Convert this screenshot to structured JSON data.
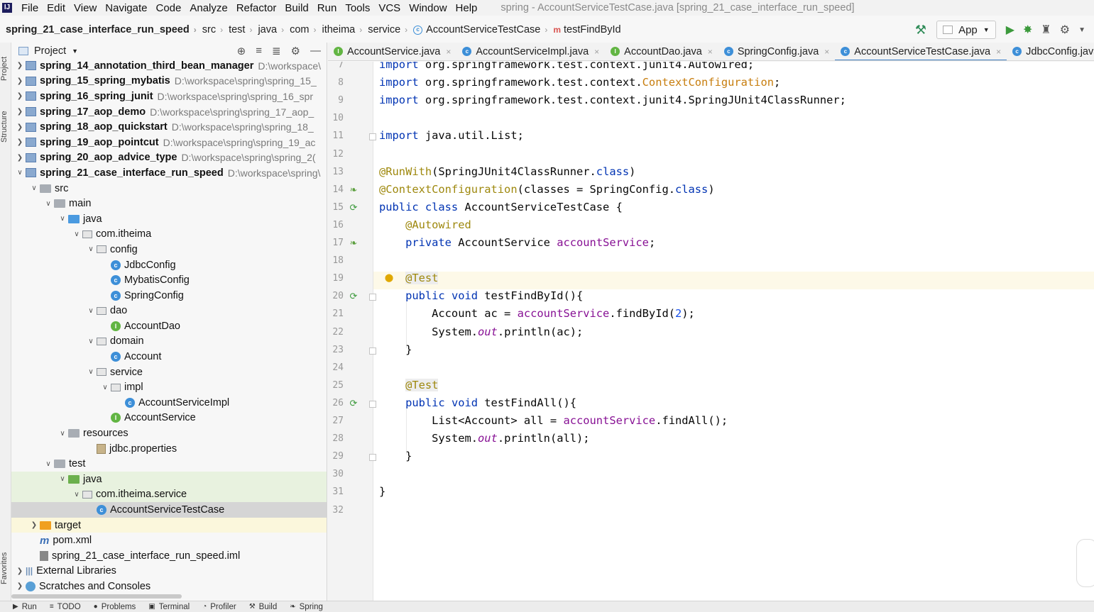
{
  "menu": {
    "items": [
      "File",
      "Edit",
      "View",
      "Navigate",
      "Code",
      "Analyze",
      "Refactor",
      "Build",
      "Run",
      "Tools",
      "VCS",
      "Window",
      "Help"
    ],
    "window_title": "spring - AccountServiceTestCase.java [spring_21_case_interface_run_speed]"
  },
  "breadcrumb": {
    "items": [
      "spring_21_case_interface_run_speed",
      "src",
      "test",
      "java",
      "com",
      "itheima",
      "service",
      "AccountServiceTestCase",
      "testFindById"
    ]
  },
  "toolbar": {
    "run_config": "App"
  },
  "side_stripe": {
    "project": "Project",
    "structure": "Structure",
    "favorites": "Favorites"
  },
  "project_panel": {
    "title": "Project",
    "tree": [
      {
        "label": "spring_14_annotation_third_bean_manager",
        "path": "D:\\workspace\\",
        "icon": "module",
        "depth": 0,
        "arrow": "right",
        "bold": true
      },
      {
        "label": "spring_15_spring_mybatis",
        "path": "D:\\workspace\\spring\\spring_15_",
        "icon": "module",
        "depth": 0,
        "arrow": "right",
        "bold": true
      },
      {
        "label": "spring_16_spring_junit",
        "path": "D:\\workspace\\spring\\spring_16_spr",
        "icon": "module",
        "depth": 0,
        "arrow": "right",
        "bold": true
      },
      {
        "label": "spring_17_aop_demo",
        "path": "D:\\workspace\\spring\\spring_17_aop_",
        "icon": "module",
        "depth": 0,
        "arrow": "right",
        "bold": true
      },
      {
        "label": "spring_18_aop_quickstart",
        "path": "D:\\workspace\\spring\\spring_18_",
        "icon": "module",
        "depth": 0,
        "arrow": "right",
        "bold": true
      },
      {
        "label": "spring_19_aop_pointcut",
        "path": "D:\\workspace\\spring\\spring_19_ac",
        "icon": "module",
        "depth": 0,
        "arrow": "right",
        "bold": true
      },
      {
        "label": "spring_20_aop_advice_type",
        "path": "D:\\workspace\\spring\\spring_2(",
        "icon": "module",
        "depth": 0,
        "arrow": "right",
        "bold": true
      },
      {
        "label": "spring_21_case_interface_run_speed",
        "path": "D:\\workspace\\spring\\",
        "icon": "module",
        "depth": 0,
        "arrow": "down",
        "bold": true
      },
      {
        "label": "src",
        "icon": "folder",
        "depth": 1,
        "arrow": "down"
      },
      {
        "label": "main",
        "icon": "folder",
        "depth": 2,
        "arrow": "down"
      },
      {
        "label": "java",
        "icon": "folder-blue",
        "depth": 3,
        "arrow": "down"
      },
      {
        "label": "com.itheima",
        "icon": "pkg",
        "depth": 4,
        "arrow": "down"
      },
      {
        "label": "config",
        "icon": "pkg",
        "depth": 5,
        "arrow": "down"
      },
      {
        "label": "JdbcConfig",
        "icon": "class-c",
        "depth": 6,
        "arrow": ""
      },
      {
        "label": "MybatisConfig",
        "icon": "class-c",
        "depth": 6,
        "arrow": ""
      },
      {
        "label": "SpringConfig",
        "icon": "class-c",
        "depth": 6,
        "arrow": ""
      },
      {
        "label": "dao",
        "icon": "pkg",
        "depth": 5,
        "arrow": "down"
      },
      {
        "label": "AccountDao",
        "icon": "iface-i",
        "depth": 6,
        "arrow": ""
      },
      {
        "label": "domain",
        "icon": "pkg",
        "depth": 5,
        "arrow": "down"
      },
      {
        "label": "Account",
        "icon": "class-c",
        "depth": 6,
        "arrow": ""
      },
      {
        "label": "service",
        "icon": "pkg",
        "depth": 5,
        "arrow": "down"
      },
      {
        "label": "impl",
        "icon": "pkg",
        "depth": 6,
        "arrow": "down"
      },
      {
        "label": "AccountServiceImpl",
        "icon": "class-c",
        "depth": 7,
        "arrow": ""
      },
      {
        "label": "AccountService",
        "icon": "iface-i",
        "depth": 6,
        "arrow": ""
      },
      {
        "label": "resources",
        "icon": "folder",
        "depth": 3,
        "arrow": "down"
      },
      {
        "label": "jdbc.properties",
        "icon": "props",
        "depth": 5,
        "arrow": ""
      },
      {
        "label": "test",
        "icon": "folder",
        "depth": 2,
        "arrow": "down"
      },
      {
        "label": "java",
        "icon": "folder-green",
        "depth": 3,
        "arrow": "down",
        "state": "green"
      },
      {
        "label": "com.itheima.service",
        "icon": "pkg",
        "depth": 4,
        "arrow": "down",
        "state": "green"
      },
      {
        "label": "AccountServiceTestCase",
        "icon": "class-c",
        "depth": 5,
        "arrow": "",
        "state": "sel"
      },
      {
        "label": "target",
        "icon": "folder-orange",
        "depth": 1,
        "arrow": "right",
        "state": "yellow"
      },
      {
        "label": "pom.xml",
        "icon": "maven",
        "depth": 1,
        "arrow": ""
      },
      {
        "label": "spring_21_case_interface_run_speed.iml",
        "icon": "iml",
        "depth": 1,
        "arrow": ""
      },
      {
        "label": "External Libraries",
        "icon": "lib",
        "depth": 0,
        "arrow": "right"
      },
      {
        "label": "Scratches and Consoles",
        "icon": "scratch",
        "depth": 0,
        "arrow": "right"
      }
    ]
  },
  "tabs": [
    {
      "label": "AccountService.java",
      "icon": "i",
      "active": false
    },
    {
      "label": "AccountServiceImpl.java",
      "icon": "c",
      "active": false
    },
    {
      "label": "AccountDao.java",
      "icon": "i",
      "active": false
    },
    {
      "label": "SpringConfig.java",
      "icon": "c",
      "active": false
    },
    {
      "label": "AccountServiceTestCase.java",
      "icon": "c",
      "active": true
    },
    {
      "label": "JdbcConfig.java",
      "icon": "c",
      "active": false
    }
  ],
  "editor": {
    "lines": [
      {
        "n": "7",
        "html": "<span class=\"kw\">import</span> org.springframework.test.context.junit4.Autowired;"
      },
      {
        "n": "8",
        "html": "<span class=\"kw\">import</span> org.springframework.test.context.<span class=\"str-cls\">ContextConfiguration</span>;"
      },
      {
        "n": "9",
        "html": "<span class=\"kw\">import</span> org.springframework.test.context.junit4.SpringJUnit4ClassRunner;"
      },
      {
        "n": "10",
        "html": ""
      },
      {
        "n": "11",
        "html": "<span class=\"kw\">import</span> java.util.List;"
      },
      {
        "n": "12",
        "html": ""
      },
      {
        "n": "13",
        "html": "<span class=\"ann\">@RunWith</span>(SpringJUnit4ClassRunner.<span class=\"kw\">class</span>)"
      },
      {
        "n": "14",
        "html": "<span class=\"ann\">@ContextConfiguration</span>(classes = SpringConfig.<span class=\"kw\">class</span>)"
      },
      {
        "n": "15",
        "html": "<span class=\"kw\">public class</span> AccountServiceTestCase {"
      },
      {
        "n": "16",
        "html": "    <span class=\"ann\">@Autowired</span>"
      },
      {
        "n": "17",
        "html": "    <span class=\"kw\">private</span> AccountService <span class=\"fld\">accountService</span>;"
      },
      {
        "n": "18",
        "html": ""
      },
      {
        "n": "19",
        "html": "    <span class=\"ann-hl\">@Test</span>"
      },
      {
        "n": "20",
        "html": "    <span class=\"kw\">public void</span> testFindById(){"
      },
      {
        "n": "21",
        "html": "        Account ac = <span class=\"fld\">accountService</span>.findById(<span class=\"num\">2</span>);"
      },
      {
        "n": "22",
        "html": "        System.<span class=\"ital\">out</span>.println(ac);"
      },
      {
        "n": "23",
        "html": "    }"
      },
      {
        "n": "24",
        "html": ""
      },
      {
        "n": "25",
        "html": "    <span class=\"ann-hl\">@Test</span>"
      },
      {
        "n": "26",
        "html": "    <span class=\"kw\">public void</span> testFindAll(){"
      },
      {
        "n": "27",
        "html": "        List&lt;Account&gt; all = <span class=\"fld\">accountService</span>.findAll();"
      },
      {
        "n": "28",
        "html": "        System.<span class=\"ital\">out</span>.println(all);"
      },
      {
        "n": "29",
        "html": "    }"
      },
      {
        "n": "30",
        "html": ""
      },
      {
        "n": "31",
        "html": "}"
      },
      {
        "n": "32",
        "html": ""
      }
    ],
    "cursor_line": "19"
  },
  "bottom_bar": {
    "items": [
      {
        "label": "Run",
        "icon": "play-icon"
      },
      {
        "label": "TODO",
        "icon": "list-icon"
      },
      {
        "label": "Problems",
        "icon": "problems-icon"
      },
      {
        "label": "Terminal",
        "icon": "terminal-icon"
      },
      {
        "label": "Profiler",
        "icon": "profiler-icon"
      },
      {
        "label": "Build",
        "icon": "hammer-icon"
      },
      {
        "label": "Spring",
        "icon": "spring-icon"
      }
    ]
  }
}
